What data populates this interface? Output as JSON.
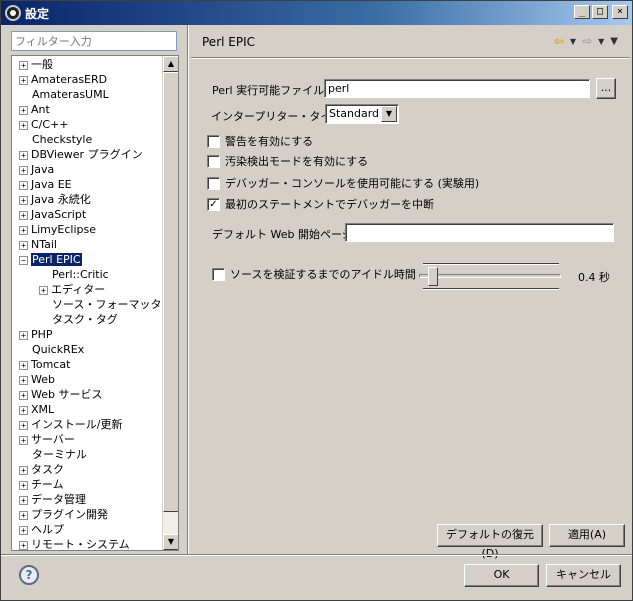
{
  "window": {
    "title": "設定"
  },
  "filter": {
    "placeholder": "フィルター入力"
  },
  "tree": {
    "items": [
      {
        "label": "一般",
        "expandable": true,
        "level": 0
      },
      {
        "label": "AmaterasERD",
        "expandable": true,
        "level": 0
      },
      {
        "label": "AmaterasUML",
        "expandable": false,
        "level": 0
      },
      {
        "label": "Ant",
        "expandable": true,
        "level": 0
      },
      {
        "label": "C/C++",
        "expandable": true,
        "level": 0
      },
      {
        "label": "Checkstyle",
        "expandable": false,
        "level": 0
      },
      {
        "label": "DBViewer プラグイン",
        "expandable": true,
        "level": 0
      },
      {
        "label": "Java",
        "expandable": true,
        "level": 0
      },
      {
        "label": "Java EE",
        "expandable": true,
        "level": 0
      },
      {
        "label": "Java 永続化",
        "expandable": true,
        "level": 0
      },
      {
        "label": "JavaScript",
        "expandable": true,
        "level": 0
      },
      {
        "label": "LimyEclipse",
        "expandable": true,
        "level": 0
      },
      {
        "label": "NTail",
        "expandable": true,
        "level": 0
      },
      {
        "label": "Perl EPIC",
        "expandable": true,
        "expanded": true,
        "level": 0,
        "selected": true
      },
      {
        "label": "Perl::Critic",
        "expandable": false,
        "level": 1
      },
      {
        "label": "エディター",
        "expandable": true,
        "level": 1
      },
      {
        "label": "ソース・フォーマッター",
        "expandable": false,
        "level": 1
      },
      {
        "label": "タスク・タグ",
        "expandable": false,
        "level": 1
      },
      {
        "label": "PHP",
        "expandable": true,
        "level": 0
      },
      {
        "label": "QuickREx",
        "expandable": false,
        "level": 0
      },
      {
        "label": "Tomcat",
        "expandable": true,
        "level": 0
      },
      {
        "label": "Web",
        "expandable": true,
        "level": 0
      },
      {
        "label": "Web サービス",
        "expandable": true,
        "level": 0
      },
      {
        "label": "XML",
        "expandable": true,
        "level": 0
      },
      {
        "label": "インストール/更新",
        "expandable": true,
        "level": 0
      },
      {
        "label": "サーバー",
        "expandable": true,
        "level": 0
      },
      {
        "label": "ターミナル",
        "expandable": false,
        "level": 0
      },
      {
        "label": "タスク",
        "expandable": true,
        "level": 0
      },
      {
        "label": "チーム",
        "expandable": true,
        "level": 0
      },
      {
        "label": "データ管理",
        "expandable": true,
        "level": 0
      },
      {
        "label": "プラグイン開発",
        "expandable": true,
        "level": 0
      },
      {
        "label": "ヘルプ",
        "expandable": true,
        "level": 0
      },
      {
        "label": "リモート・システム",
        "expandable": true,
        "level": 0
      }
    ]
  },
  "page": {
    "title": "Perl EPIC",
    "perl_exe_label": "Perl 実行可能ファイル:",
    "perl_exe_value": "perl",
    "browse_label": "...",
    "interpreter_label": "インタープリター・タイプ:",
    "interpreter_value": "Standard",
    "checks": [
      {
        "label": "警告を有効にする",
        "checked": false
      },
      {
        "label": "汚染検出モードを有効にする",
        "checked": false
      },
      {
        "label": "デバッガー・コンソールを使用可能にする (実験用)",
        "checked": false
      },
      {
        "label": "最初のステートメントでデバッガーを中断",
        "checked": true
      }
    ],
    "web_start_label": "デフォルト Web 開始ページ:",
    "web_start_value": "",
    "idle_check_label": "ソースを検証するまでのアイドル時間",
    "idle_checked": false,
    "idle_value_text": "0.4 秒",
    "idle_slider_fraction": 0.04,
    "restore_defaults": "デフォルトの復元(D)",
    "apply": "適用(A)"
  },
  "footer": {
    "ok": "OK",
    "cancel": "キャンセル",
    "help_glyph": "?"
  },
  "icons": {
    "back": "back-arrow-icon",
    "forward": "forward-arrow-icon",
    "menu": "view-menu-icon",
    "help": "help-icon"
  }
}
